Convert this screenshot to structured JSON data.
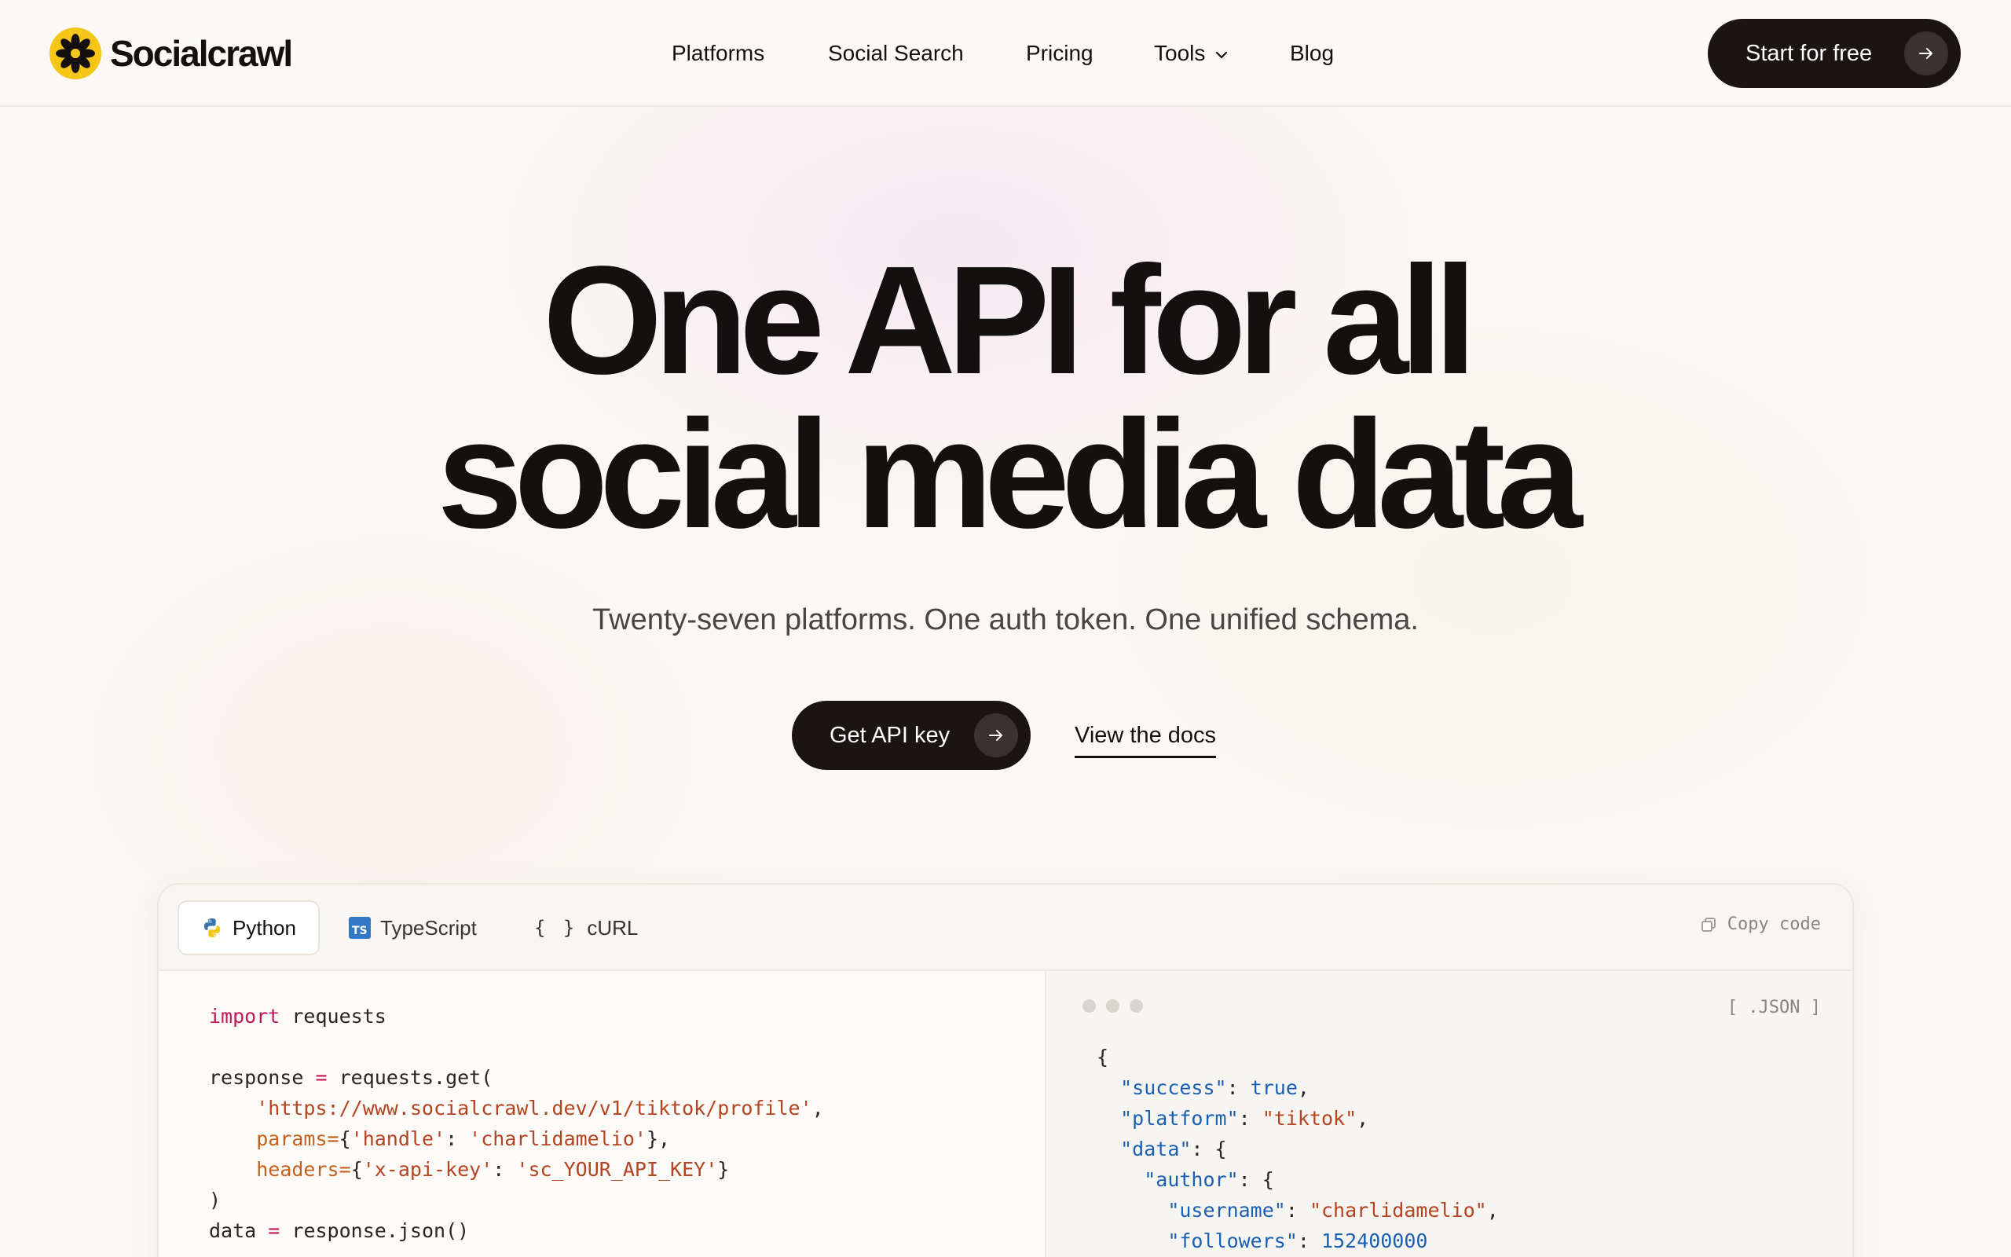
{
  "brand": {
    "name": "Socialcrawl",
    "accent": "#f5c518"
  },
  "nav": {
    "links": [
      "Platforms",
      "Social Search",
      "Pricing",
      "Tools",
      "Blog"
    ],
    "cta": "Start for free"
  },
  "hero": {
    "title_line1": "One API for all",
    "title_line2": "social media data",
    "subtitle": "Twenty-seven platforms. One auth token. One unified schema.",
    "primary_cta": "Get API key",
    "secondary_cta": "View the docs"
  },
  "code": {
    "tabs": [
      "Python",
      "TypeScript",
      "cURL"
    ],
    "curl_icon": "{ }",
    "active_tab": "Python",
    "copy_label": "Copy code",
    "format_label": "[ .JSON ]",
    "python": {
      "import_kw": "import",
      "import_mod": "requests",
      "response_var": "response",
      "assign": "=",
      "call": "requests.get(",
      "url": "'https://www.socialcrawl.dev/v1/tiktok/profile'",
      "params_kw": "params=",
      "params_key": "'handle'",
      "params_val": "'charlidamelio'",
      "headers_kw": "headers=",
      "headers_key": "'x-api-key'",
      "headers_val": "'sc_YOUR_API_KEY'",
      "close": ")",
      "data_var": "data",
      "data_call": "response.json()"
    },
    "json": {
      "open": "{",
      "success_key": "\"success\"",
      "success_val": "true",
      "platform_key": "\"platform\"",
      "platform_val": "\"tiktok\"",
      "data_key": "\"data\"",
      "author_key": "\"author\"",
      "username_key": "\"username\"",
      "username_val": "\"charlidamelio\"",
      "followers_key": "\"followers\"",
      "followers_val": "152400000"
    }
  }
}
